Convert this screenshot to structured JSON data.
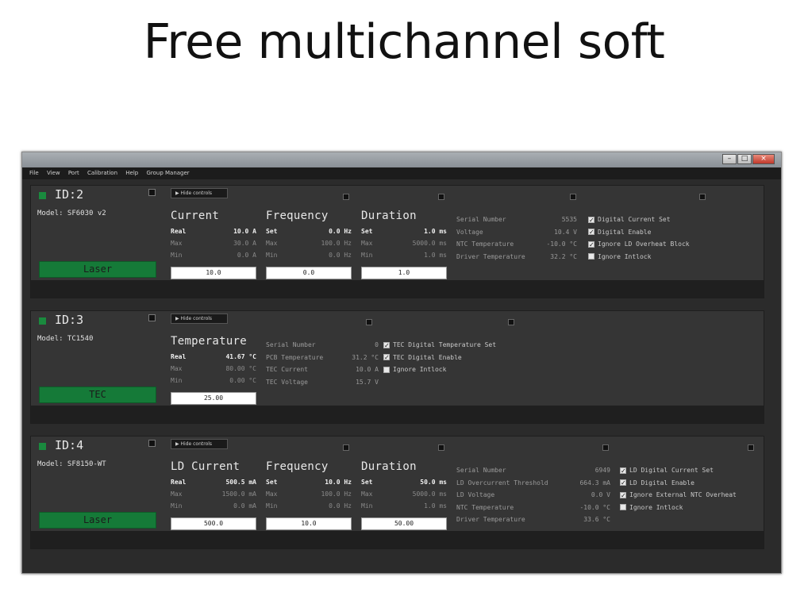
{
  "slide": {
    "title": "Free multichannel soft"
  },
  "menu": [
    "File",
    "View",
    "Port",
    "Calibration",
    "Help",
    "Group Manager"
  ],
  "window": {
    "controls": [
      "–",
      "□",
      "×"
    ]
  },
  "channels": [
    {
      "id": "ID:2",
      "model": "Model: SF6030 v2",
      "hide_label": "▶  Hide controls",
      "mode_button": "Laser",
      "blocks": [
        {
          "title": "Current",
          "main_label": "Real",
          "main_value": "10.0 A",
          "max_label": "Max",
          "max_value": "30.0 A",
          "min_label": "Min",
          "min_value": "0.0 A",
          "input": "10.0"
        },
        {
          "title": "Frequency",
          "main_label": "Set",
          "main_value": "0.0 Hz",
          "max_label": "Max",
          "max_value": "100.0 Hz",
          "min_label": "Min",
          "min_value": "0.0 Hz",
          "input": "0.0"
        },
        {
          "title": "Duration",
          "main_label": "Set",
          "main_value": "1.0 ms",
          "max_label": "Max",
          "max_value": "5000.0 ms",
          "min_label": "Min",
          "min_value": "1.0 ms",
          "input": "1.0"
        }
      ],
      "info": [
        {
          "k": "Serial Number",
          "v": "5535"
        },
        {
          "k": "Voltage",
          "v": "10.4  V"
        },
        {
          "k": "NTC Temperature",
          "v": "-10.0 °C"
        },
        {
          "k": "Driver Temperature",
          "v": "32.2 °C"
        }
      ],
      "checks": [
        {
          "label": "Digital Current Set",
          "checked": true
        },
        {
          "label": "Digital Enable",
          "checked": true
        },
        {
          "label": "Ignore LD Overheat Block",
          "checked": true
        },
        {
          "label": "Ignore Intlock",
          "checked": false
        }
      ]
    },
    {
      "id": "ID:3",
      "model": "Model: TC1540",
      "hide_label": "▶  Hide controls",
      "mode_button": "TEC",
      "blocks": [
        {
          "title": "Temperature",
          "main_label": "Real",
          "main_value": "41.67 °C",
          "max_label": "Max",
          "max_value": "80.00 °C",
          "min_label": "Min",
          "min_value": "0.00 °C",
          "input": "25.00"
        }
      ],
      "info": [
        {
          "k": "Serial Number",
          "v": "0"
        },
        {
          "k": "PCB Temperature",
          "v": "31.2 °C"
        },
        {
          "k": "TEC Current",
          "v": "10.0  A"
        },
        {
          "k": "TEC Voltage",
          "v": "15.7  V"
        }
      ],
      "checks": [
        {
          "label": "TEC Digital Temperature Set",
          "checked": true
        },
        {
          "label": "TEC Digital Enable",
          "checked": true
        },
        {
          "label": "Ignore Intlock",
          "checked": false
        }
      ]
    },
    {
      "id": "ID:4",
      "model": "Model: SF8150-WT",
      "hide_label": "▶  Hide controls",
      "mode_button": "Laser",
      "blocks": [
        {
          "title": "LD Current",
          "main_label": "Real",
          "main_value": "500.5 mA",
          "max_label": "Max",
          "max_value": "1500.0 mA",
          "min_label": "Min",
          "min_value": "0.0 mA",
          "input": "500.0"
        },
        {
          "title": "Frequency",
          "main_label": "Set",
          "main_value": "10.0 Hz",
          "max_label": "Max",
          "max_value": "100.0 Hz",
          "min_label": "Min",
          "min_value": "0.0 Hz",
          "input": "10.0"
        },
        {
          "title": "Duration",
          "main_label": "Set",
          "main_value": "50.0 ms",
          "max_label": "Max",
          "max_value": "5000.0 ms",
          "min_label": "Min",
          "min_value": "1.0 ms",
          "input": "50.00"
        }
      ],
      "info": [
        {
          "k": "Serial Number",
          "v": "6949"
        },
        {
          "k": "LD Overcurrent Threshold",
          "v": "664.3 mA"
        },
        {
          "k": "LD Voltage",
          "v": "0.0  V"
        },
        {
          "k": "NTC Temperature",
          "v": "-10.0 °C"
        },
        {
          "k": "Driver Temperature",
          "v": "33.6 °C"
        }
      ],
      "checks": [
        {
          "label": "LD Digital Current Set",
          "checked": true
        },
        {
          "label": "LD Digital Enable",
          "checked": true
        },
        {
          "label": "Ignore External NTC Overheat",
          "checked": true
        },
        {
          "label": "Ignore Intlock",
          "checked": false
        }
      ]
    }
  ]
}
